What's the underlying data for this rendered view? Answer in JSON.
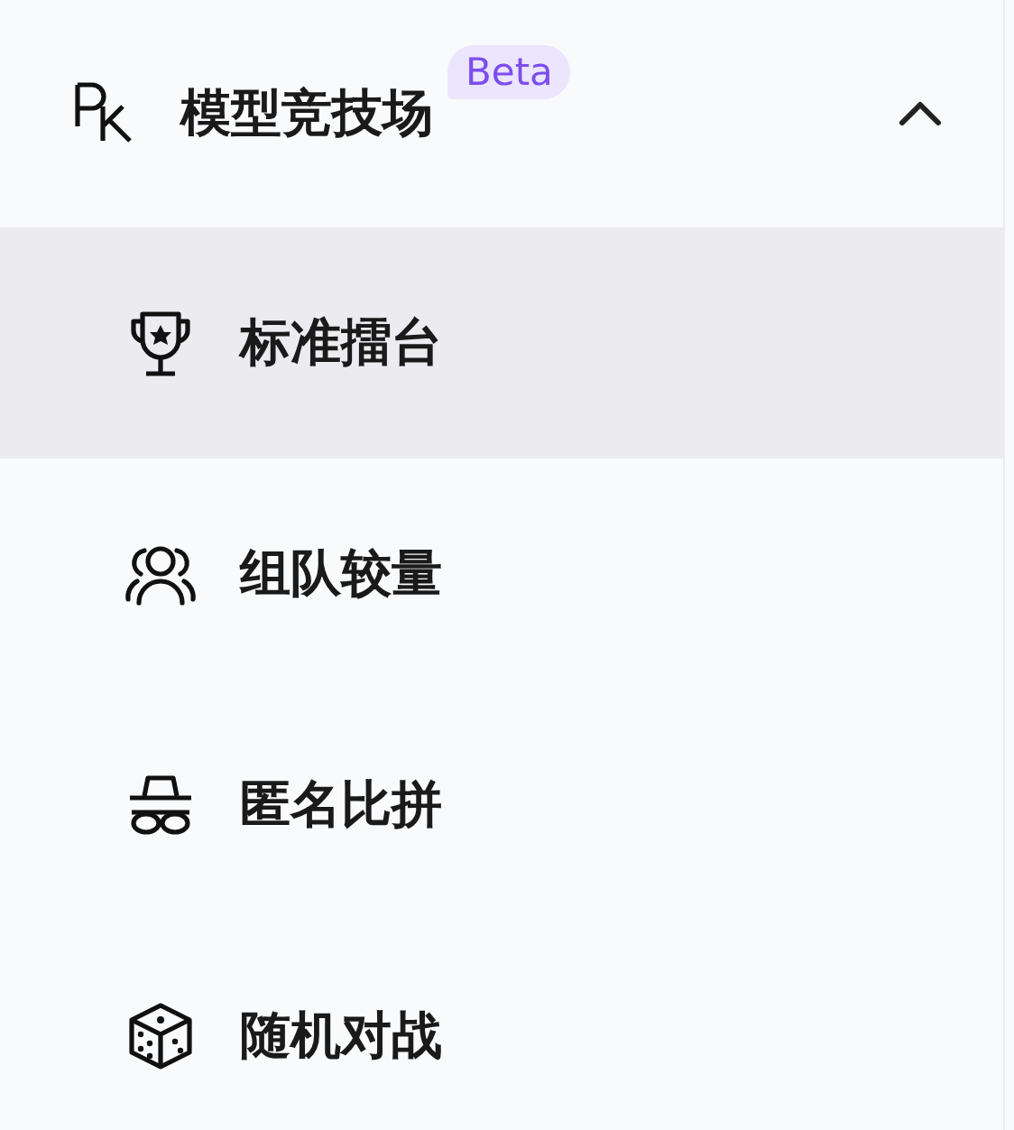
{
  "menu": {
    "title": "模型竞技场",
    "badge": "Beta",
    "expanded": true,
    "items": [
      {
        "label": "标准擂台",
        "selected": true
      },
      {
        "label": "组队较量",
        "selected": false
      },
      {
        "label": "匿名比拼",
        "selected": false
      },
      {
        "label": "随机对战",
        "selected": false
      }
    ]
  }
}
